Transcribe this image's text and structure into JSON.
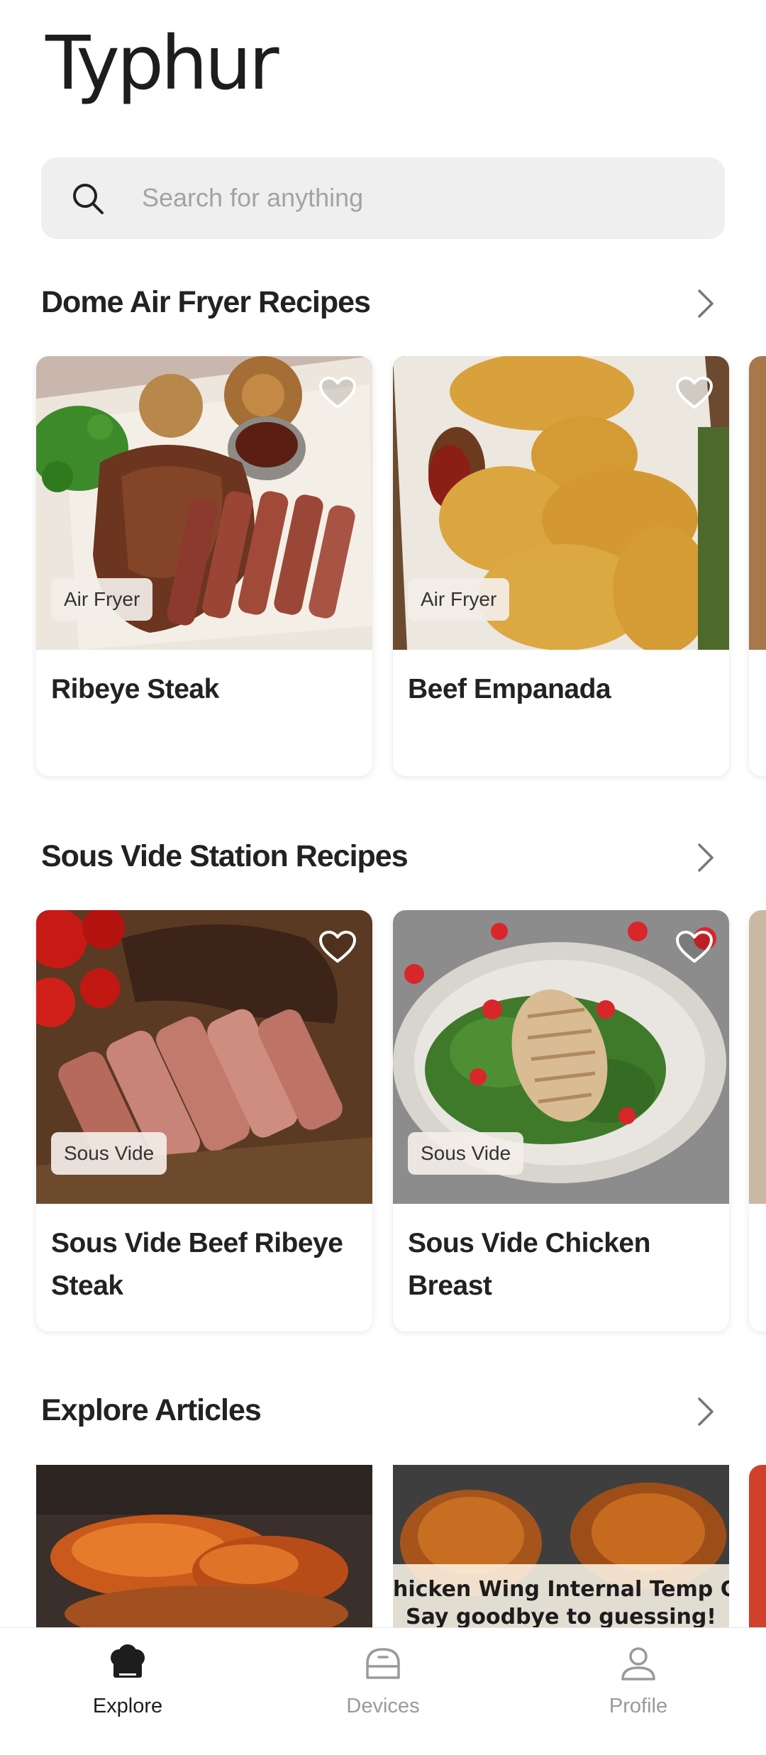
{
  "app": {
    "logo_text": "Typhur"
  },
  "search": {
    "placeholder": "Search for anything",
    "icon": "search-icon"
  },
  "sections": [
    {
      "title": "Dome Air Fryer Recipes",
      "cards": [
        {
          "title": "Ribeye Steak",
          "tag": "Air Fryer"
        },
        {
          "title": "Beef Empanada",
          "tag": "Air Fryer"
        }
      ]
    },
    {
      "title": "Sous Vide Station Recipes",
      "cards": [
        {
          "title": "Sous Vide Beef Ribeye Steak",
          "tag": "Sous Vide"
        },
        {
          "title": "Sous Vide Chicken Breast",
          "tag": "Sous Vide"
        }
      ]
    },
    {
      "title": "Explore Articles",
      "articles": [
        {
          "caption_line1": "",
          "caption_line2": ""
        },
        {
          "caption_line1": "hicken Wing Internal Temp Gui",
          "caption_line2": "Say goodbye to guessing!"
        }
      ]
    }
  ],
  "bottom_nav": [
    {
      "label": "Explore",
      "icon": "chef-hat-icon",
      "active": true
    },
    {
      "label": "Devices",
      "icon": "device-icon",
      "active": false
    },
    {
      "label": "Profile",
      "icon": "person-icon",
      "active": false
    }
  ],
  "colors": {
    "active": "#1d1d1d",
    "inactive": "#9a9a9a",
    "search_bg": "#efefef"
  }
}
